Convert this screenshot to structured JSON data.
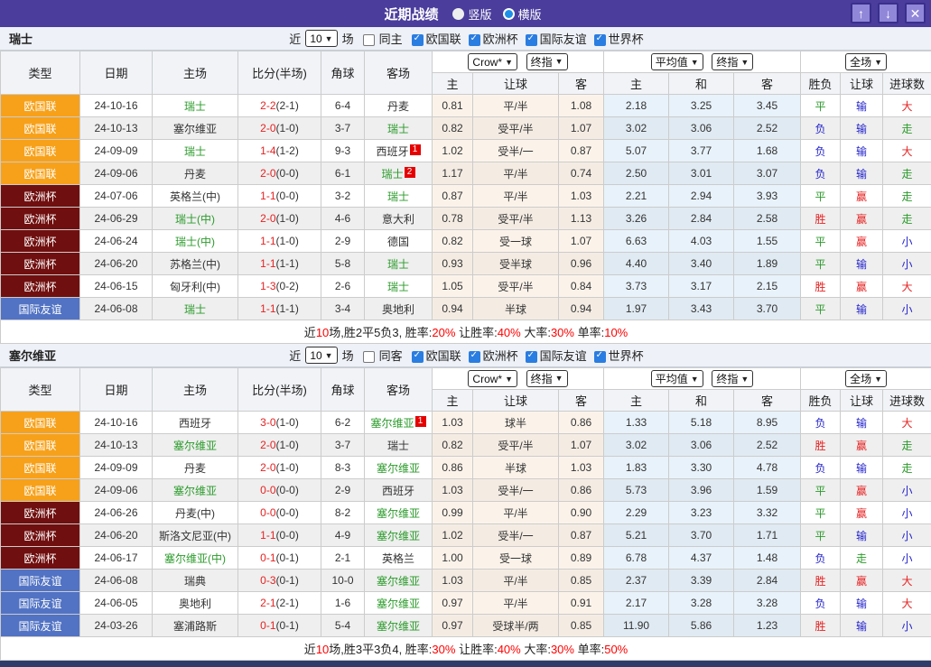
{
  "titlebar": {
    "title": "近期战绩",
    "vertical_label": "竖版",
    "horizontal_label": "横版",
    "vertical_selected": false,
    "horizontal_selected": true,
    "icons": {
      "up": "↑",
      "down": "↓",
      "close": "✕"
    }
  },
  "columns": {
    "type": "类型",
    "date": "日期",
    "home": "主场",
    "score": "比分(半场)",
    "corner": "角球",
    "away": "客场",
    "sub": [
      "主",
      "让球",
      "客",
      "主",
      "和",
      "客",
      "胜负",
      "让球",
      "进球数"
    ]
  },
  "dropdowns": {
    "company": "Crow*",
    "company_stage": "终指",
    "average": "平均值",
    "average_stage": "终指",
    "scope": "全场"
  },
  "filter_labels": {
    "near": "近",
    "games": "场",
    "leagues": [
      "欧国联",
      "欧洲杯",
      "国际友谊",
      "世界杯"
    ]
  },
  "colors": {
    "titlebar_bg": "#4a3d9c",
    "button_bg": "#9187d9",
    "type_nations_league": "#f7a11a",
    "type_euro_cup": "#700f0f",
    "type_friendly": "#5273c4",
    "score_red": "#e62222",
    "focus_team_green": "#2b9b2b",
    "result_red": "#e62222",
    "result_green": "#2b9b2b",
    "result_blue": "#2424cc",
    "summary_red": "#ff0000",
    "bottom_bar": "#2d3c6a"
  },
  "sections": [
    {
      "team": "瑞士",
      "period": "10",
      "same_label": "同主",
      "same_checked": false,
      "leagues_checked": [
        true,
        true,
        true,
        true
      ],
      "rows": [
        {
          "type": "欧国联",
          "date": "24-10-16",
          "home": "瑞士",
          "homeFocus": true,
          "score": "2-2",
          "half": "(2-1)",
          "corner": "6-4",
          "away": "丹麦",
          "crow": [
            "0.81",
            "平/半",
            "1.08"
          ],
          "avg": [
            "2.18",
            "3.25",
            "3.45"
          ],
          "results": [
            "平",
            "输",
            "大"
          ]
        },
        {
          "type": "欧国联",
          "date": "24-10-13",
          "home": "塞尔维亚",
          "score": "2-0",
          "half": "(1-0)",
          "corner": "3-7",
          "away": "瑞士",
          "awayFocus": true,
          "crow": [
            "0.82",
            "受平/半",
            "1.07"
          ],
          "avg": [
            "3.02",
            "3.06",
            "2.52"
          ],
          "results": [
            "负",
            "输",
            "走"
          ]
        },
        {
          "type": "欧国联",
          "date": "24-09-09",
          "home": "瑞士",
          "homeFocus": true,
          "score": "1-4",
          "half": "(1-2)",
          "corner": "9-3",
          "away": "西班牙",
          "awayBadge": "1",
          "crow": [
            "1.02",
            "受半/一",
            "0.87"
          ],
          "avg": [
            "5.07",
            "3.77",
            "1.68"
          ],
          "results": [
            "负",
            "输",
            "大"
          ]
        },
        {
          "type": "欧国联",
          "date": "24-09-06",
          "home": "丹麦",
          "score": "2-0",
          "half": "(0-0)",
          "corner": "6-1",
          "away": "瑞士",
          "awayFocus": true,
          "awayBadge": "2",
          "crow": [
            "1.17",
            "平/半",
            "0.74"
          ],
          "avg": [
            "2.50",
            "3.01",
            "3.07"
          ],
          "results": [
            "负",
            "输",
            "走"
          ]
        },
        {
          "type": "欧洲杯",
          "date": "24-07-06",
          "home": "英格兰(中)",
          "score": "1-1",
          "half": "(0-0)",
          "corner": "3-2",
          "away": "瑞士",
          "awayFocus": true,
          "crow": [
            "0.87",
            "平/半",
            "1.03"
          ],
          "avg": [
            "2.21",
            "2.94",
            "3.93"
          ],
          "results": [
            "平",
            "赢",
            "走"
          ]
        },
        {
          "type": "欧洲杯",
          "date": "24-06-29",
          "home": "瑞士(中)",
          "homeFocus": true,
          "score": "2-0",
          "half": "(1-0)",
          "corner": "4-6",
          "away": "意大利",
          "crow": [
            "0.78",
            "受平/半",
            "1.13"
          ],
          "avg": [
            "3.26",
            "2.84",
            "2.58"
          ],
          "results": [
            "胜",
            "赢",
            "走"
          ]
        },
        {
          "type": "欧洲杯",
          "date": "24-06-24",
          "home": "瑞士(中)",
          "homeFocus": true,
          "score": "1-1",
          "half": "(1-0)",
          "corner": "2-9",
          "away": "德国",
          "crow": [
            "0.82",
            "受一球",
            "1.07"
          ],
          "avg": [
            "6.63",
            "4.03",
            "1.55"
          ],
          "results": [
            "平",
            "赢",
            "小"
          ]
        },
        {
          "type": "欧洲杯",
          "date": "24-06-20",
          "home": "苏格兰(中)",
          "score": "1-1",
          "half": "(1-1)",
          "corner": "5-8",
          "away": "瑞士",
          "awayFocus": true,
          "crow": [
            "0.93",
            "受半球",
            "0.96"
          ],
          "avg": [
            "4.40",
            "3.40",
            "1.89"
          ],
          "results": [
            "平",
            "输",
            "小"
          ]
        },
        {
          "type": "欧洲杯",
          "date": "24-06-15",
          "home": "匈牙利(中)",
          "score": "1-3",
          "half": "(0-2)",
          "corner": "2-6",
          "away": "瑞士",
          "awayFocus": true,
          "crow": [
            "1.05",
            "受平/半",
            "0.84"
          ],
          "avg": [
            "3.73",
            "3.17",
            "2.15"
          ],
          "results": [
            "胜",
            "赢",
            "大"
          ]
        },
        {
          "type": "国际友谊",
          "date": "24-06-08",
          "home": "瑞士",
          "homeFocus": true,
          "score": "1-1",
          "half": "(1-1)",
          "corner": "3-4",
          "away": "奥地利",
          "crow": [
            "0.94",
            "半球",
            "0.94"
          ],
          "avg": [
            "1.97",
            "3.43",
            "3.70"
          ],
          "results": [
            "平",
            "输",
            "小"
          ]
        }
      ],
      "summary": [
        {
          "t": "近"
        },
        {
          "t": "10",
          "red": true
        },
        {
          "t": "场,胜2平5负3, 胜率:"
        },
        {
          "t": "20%",
          "red": true
        },
        {
          "t": " 让胜率:"
        },
        {
          "t": "40%",
          "red": true
        },
        {
          "t": " 大率:"
        },
        {
          "t": "30%",
          "red": true
        },
        {
          "t": " 单率:"
        },
        {
          "t": "10%",
          "red": true
        }
      ]
    },
    {
      "team": "塞尔维亚",
      "period": "10",
      "same_label": "同客",
      "same_checked": false,
      "leagues_checked": [
        true,
        true,
        true,
        true
      ],
      "rows": [
        {
          "type": "欧国联",
          "date": "24-10-16",
          "home": "西班牙",
          "score": "3-0",
          "half": "(1-0)",
          "corner": "6-2",
          "away": "塞尔维亚",
          "awayFocus": true,
          "awayBadge": "1",
          "crow": [
            "1.03",
            "球半",
            "0.86"
          ],
          "avg": [
            "1.33",
            "5.18",
            "8.95"
          ],
          "results": [
            "负",
            "输",
            "大"
          ]
        },
        {
          "type": "欧国联",
          "date": "24-10-13",
          "home": "塞尔维亚",
          "homeFocus": true,
          "score": "2-0",
          "half": "(1-0)",
          "corner": "3-7",
          "away": "瑞士",
          "crow": [
            "0.82",
            "受平/半",
            "1.07"
          ],
          "avg": [
            "3.02",
            "3.06",
            "2.52"
          ],
          "results": [
            "胜",
            "赢",
            "走"
          ]
        },
        {
          "type": "欧国联",
          "date": "24-09-09",
          "home": "丹麦",
          "score": "2-0",
          "half": "(1-0)",
          "corner": "8-3",
          "away": "塞尔维亚",
          "awayFocus": true,
          "crow": [
            "0.86",
            "半球",
            "1.03"
          ],
          "avg": [
            "1.83",
            "3.30",
            "4.78"
          ],
          "results": [
            "负",
            "输",
            "走"
          ]
        },
        {
          "type": "欧国联",
          "date": "24-09-06",
          "home": "塞尔维亚",
          "homeFocus": true,
          "score": "0-0",
          "half": "(0-0)",
          "corner": "2-9",
          "away": "西班牙",
          "crow": [
            "1.03",
            "受半/一",
            "0.86"
          ],
          "avg": [
            "5.73",
            "3.96",
            "1.59"
          ],
          "results": [
            "平",
            "赢",
            "小"
          ]
        },
        {
          "type": "欧洲杯",
          "date": "24-06-26",
          "home": "丹麦(中)",
          "score": "0-0",
          "half": "(0-0)",
          "corner": "8-2",
          "away": "塞尔维亚",
          "awayFocus": true,
          "crow": [
            "0.99",
            "平/半",
            "0.90"
          ],
          "avg": [
            "2.29",
            "3.23",
            "3.32"
          ],
          "results": [
            "平",
            "赢",
            "小"
          ]
        },
        {
          "type": "欧洲杯",
          "date": "24-06-20",
          "home": "斯洛文尼亚(中)",
          "score": "1-1",
          "half": "(0-0)",
          "corner": "4-9",
          "away": "塞尔维亚",
          "awayFocus": true,
          "crow": [
            "1.02",
            "受半/一",
            "0.87"
          ],
          "avg": [
            "5.21",
            "3.70",
            "1.71"
          ],
          "results": [
            "平",
            "输",
            "小"
          ]
        },
        {
          "type": "欧洲杯",
          "date": "24-06-17",
          "home": "塞尔维亚(中)",
          "homeFocus": true,
          "score": "0-1",
          "half": "(0-1)",
          "corner": "2-1",
          "away": "英格兰",
          "crow": [
            "1.00",
            "受一球",
            "0.89"
          ],
          "avg": [
            "6.78",
            "4.37",
            "1.48"
          ],
          "results": [
            "负",
            "走",
            "小"
          ]
        },
        {
          "type": "国际友谊",
          "date": "24-06-08",
          "home": "瑞典",
          "score": "0-3",
          "half": "(0-1)",
          "corner": "10-0",
          "away": "塞尔维亚",
          "awayFocus": true,
          "crow": [
            "1.03",
            "平/半",
            "0.85"
          ],
          "avg": [
            "2.37",
            "3.39",
            "2.84"
          ],
          "results": [
            "胜",
            "赢",
            "大"
          ]
        },
        {
          "type": "国际友谊",
          "date": "24-06-05",
          "home": "奥地利",
          "score": "2-1",
          "half": "(2-1)",
          "corner": "1-6",
          "away": "塞尔维亚",
          "awayFocus": true,
          "crow": [
            "0.97",
            "平/半",
            "0.91"
          ],
          "avg": [
            "2.17",
            "3.28",
            "3.28"
          ],
          "results": [
            "负",
            "输",
            "大"
          ]
        },
        {
          "type": "国际友谊",
          "date": "24-03-26",
          "home": "塞浦路斯",
          "score": "0-1",
          "half": "(0-1)",
          "corner": "5-4",
          "away": "塞尔维亚",
          "awayFocus": true,
          "crow": [
            "0.97",
            "受球半/两",
            "0.85"
          ],
          "avg": [
            "11.90",
            "5.86",
            "1.23"
          ],
          "results": [
            "胜",
            "输",
            "小"
          ]
        }
      ],
      "summary": [
        {
          "t": "近"
        },
        {
          "t": "10",
          "red": true
        },
        {
          "t": "场,胜3平3负4, 胜率:"
        },
        {
          "t": "30%",
          "red": true
        },
        {
          "t": " 让胜率:"
        },
        {
          "t": "40%",
          "red": true
        },
        {
          "t": " 大率:"
        },
        {
          "t": "30%",
          "red": true
        },
        {
          "t": " 单率:"
        },
        {
          "t": "50%",
          "red": true
        }
      ]
    }
  ]
}
